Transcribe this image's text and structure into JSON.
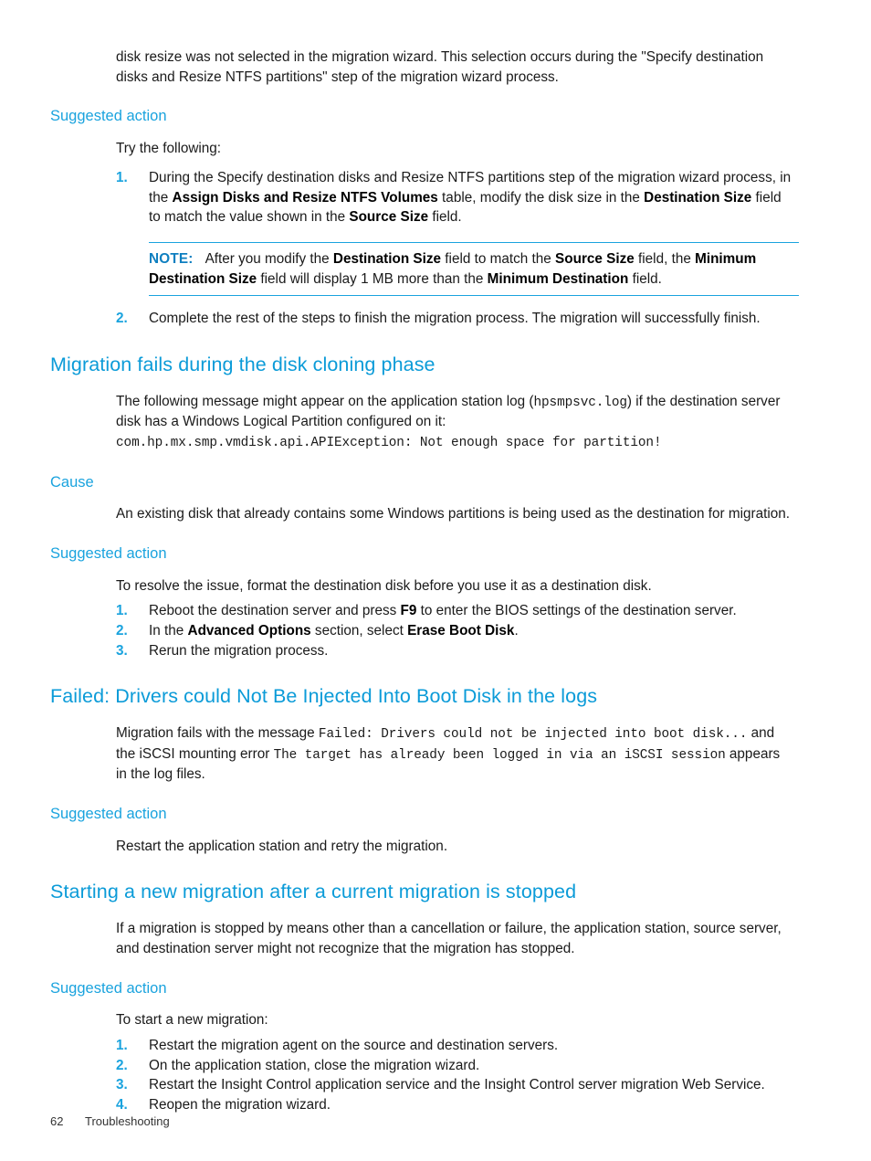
{
  "document": {
    "footer": {
      "page_number": "62",
      "chapter": "Troubleshooting"
    },
    "colors": {
      "heading_blue": "#0b9bd8",
      "subheading_blue": "#1aa3de",
      "note_blue": "#0e7fc0",
      "body_text": "#1a1a1a"
    }
  },
  "intro": {
    "continued_paragraph_line1": "disk resize was not selected in the migration wizard. This selection occurs during the \"Specify",
    "continued_paragraph_line2": "destination disks and Resize NTFS partitions\" step of the migration wizard process."
  },
  "section1": {
    "suggested_action_heading": "Suggested action",
    "lead_in": "Try the following:",
    "steps": [
      {
        "marker": "1.",
        "part1": "During the Specify destination disks and Resize NTFS partitions step of the migration wizard process, in the ",
        "bold1": "Assign Disks and Resize NTFS Volumes",
        "part2": " table, modify the disk size in the ",
        "bold2": "Destination Size",
        "part3": " field to match the value shown in the ",
        "bold3": "Source Size",
        "part4": " field."
      },
      {
        "marker": "2.",
        "part1": "Complete the rest of the steps to finish the migration process. The migration will successfully finish.",
        "bold1": "",
        "part2": "",
        "bold2": "",
        "part3": "",
        "bold3": "",
        "part4": ""
      }
    ],
    "note": {
      "label": "NOTE:",
      "t1": "After you modify the ",
      "b1": "Destination Size",
      "t2": " field to match the ",
      "b2": "Source Size",
      "t3": " field, the ",
      "b3": "Minimum Destination Size",
      "t4": " field will display 1 MB more than the ",
      "b4": "Minimum Destination",
      "t5": " field."
    }
  },
  "section2": {
    "title": "Migration fails during the disk cloning phase",
    "para_t1": "The following message might appear on the application station log (",
    "para_code1": "hpsmpsvc.log",
    "para_t2": ") if the destination server disk has a Windows Logical Partition configured on it:",
    "code_block": "com.hp.mx.smp.vmdisk.api.APIException: Not enough space for partition!",
    "cause_heading": "Cause",
    "cause_text": "An existing disk that already contains some Windows partitions is being used as the destination for migration.",
    "suggested_action_heading": "Suggested action",
    "lead_in": "To resolve the issue, format the destination disk before you use it as a destination disk.",
    "steps": [
      {
        "marker": "1.",
        "part1": "Reboot the destination server and press ",
        "bold1": "F9",
        "part2": " to enter the BIOS settings of the destination server.",
        "bold2": "",
        "part3": ""
      },
      {
        "marker": "2.",
        "part1": "In the ",
        "bold1": "Advanced Options",
        "part2": " section, select ",
        "bold2": "Erase Boot Disk",
        "part3": "."
      },
      {
        "marker": "3.",
        "part1": "Rerun the migration process.",
        "bold1": "",
        "part2": "",
        "bold2": "",
        "part3": ""
      }
    ]
  },
  "section3": {
    "title": "Failed: Drivers could Not Be Injected Into Boot Disk in the logs",
    "para_t1": "Migration fails with the message ",
    "para_code1": "Failed: Drivers could not be injected into boot disk...",
    "para_t2": " and the iSCSI mounting error ",
    "para_code2": "The target has already been logged in via an iSCSI session",
    "para_t3": " appears in the log files.",
    "suggested_action_heading": "Suggested action",
    "suggested_action_text": "Restart the application station and retry the migration."
  },
  "section4": {
    "title": "Starting a new migration after a current migration is stopped",
    "para": "If a migration is stopped by means other than a cancellation or failure, the application station, source server, and destination server might not recognize that the migration has stopped.",
    "suggested_action_heading": "Suggested action",
    "lead_in": "To start a new migration:",
    "steps": [
      {
        "marker": "1.",
        "text": "Restart the migration agent on the source and destination servers."
      },
      {
        "marker": "2.",
        "text": "On the application station, close the migration wizard."
      },
      {
        "marker": "3.",
        "text": "Restart the Insight Control application service and the Insight Control server migration Web Service."
      },
      {
        "marker": "4.",
        "text": "Reopen the migration wizard."
      }
    ]
  }
}
